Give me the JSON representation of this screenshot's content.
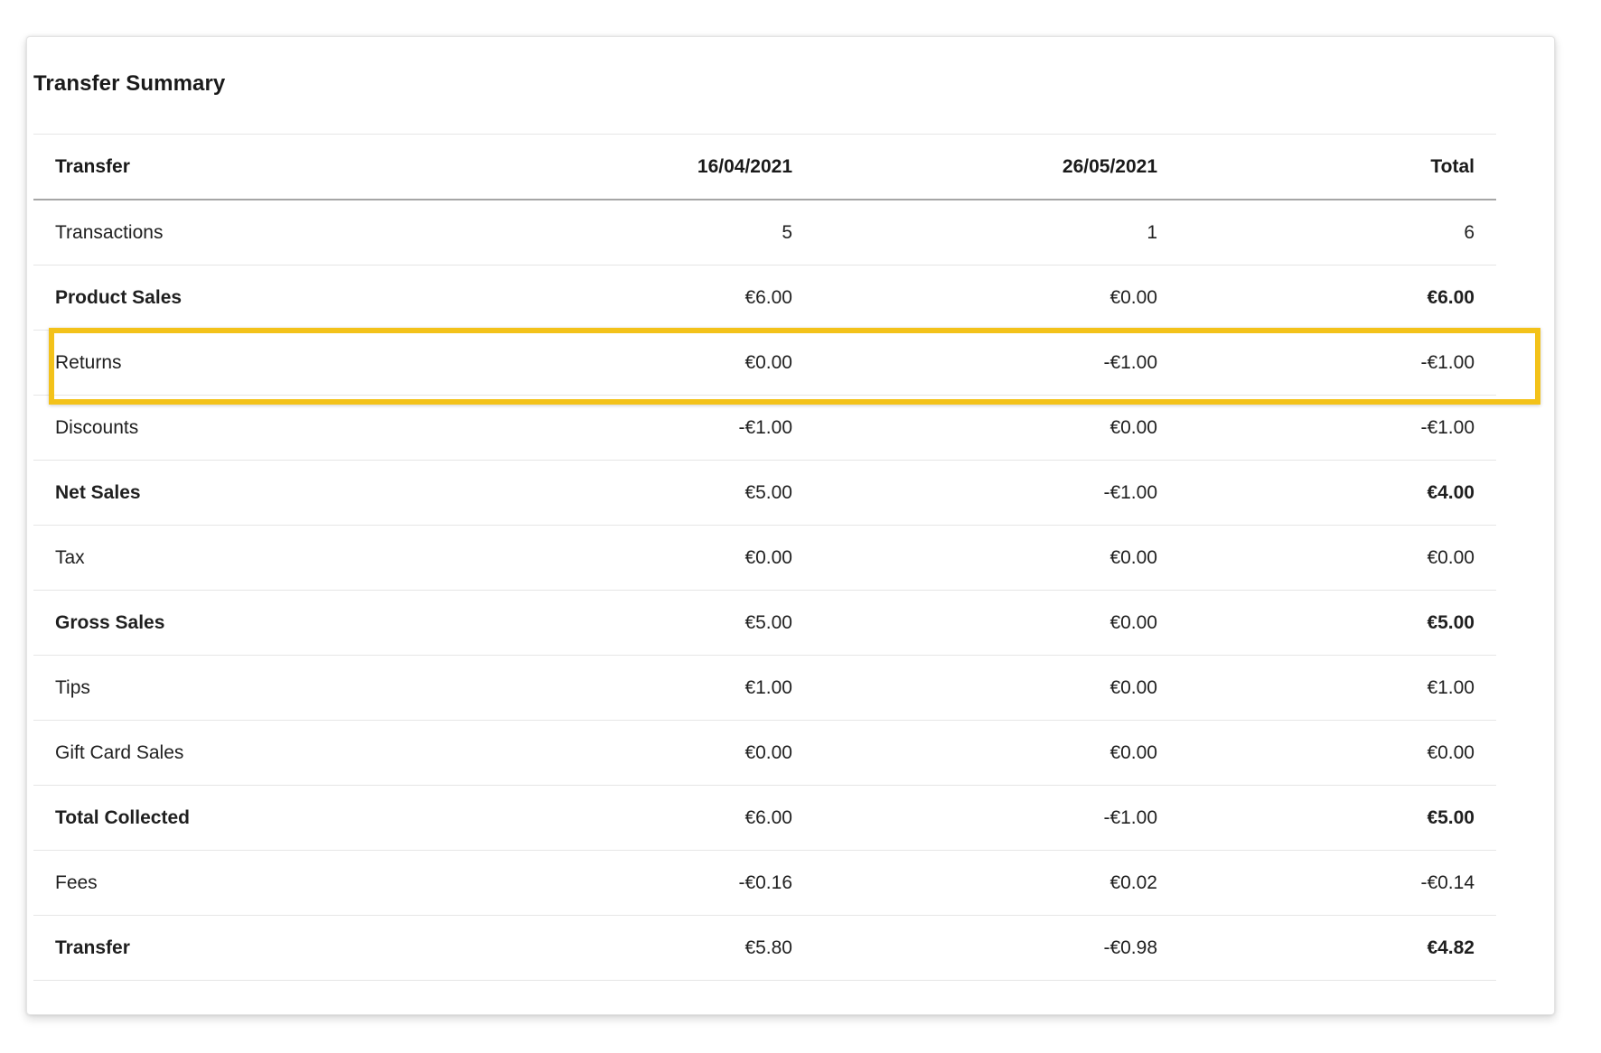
{
  "title": "Transfer Summary",
  "columns": [
    "Transfer",
    "16/04/2021",
    "26/05/2021",
    "Total"
  ],
  "rows": [
    {
      "label": "Transactions",
      "values": [
        "5",
        "1",
        "6"
      ],
      "bold": false
    },
    {
      "label": "Product Sales",
      "values": [
        "€6.00",
        "€0.00",
        "€6.00"
      ],
      "bold": true
    },
    {
      "label": "Returns",
      "values": [
        "€0.00",
        "-€1.00",
        "-€1.00"
      ],
      "bold": false
    },
    {
      "label": "Discounts",
      "values": [
        "-€1.00",
        "€0.00",
        "-€1.00"
      ],
      "bold": false
    },
    {
      "label": "Net Sales",
      "values": [
        "€5.00",
        "-€1.00",
        "€4.00"
      ],
      "bold": true
    },
    {
      "label": "Tax",
      "values": [
        "€0.00",
        "€0.00",
        "€0.00"
      ],
      "bold": false
    },
    {
      "label": "Gross Sales",
      "values": [
        "€5.00",
        "€0.00",
        "€5.00"
      ],
      "bold": true
    },
    {
      "label": "Tips",
      "values": [
        "€1.00",
        "€0.00",
        "€1.00"
      ],
      "bold": false
    },
    {
      "label": "Gift Card Sales",
      "values": [
        "€0.00",
        "€0.00",
        "€0.00"
      ],
      "bold": false
    },
    {
      "label": "Total Collected",
      "values": [
        "€6.00",
        "-€1.00",
        "€5.00"
      ],
      "bold": true
    },
    {
      "label": "Fees",
      "values": [
        "-€0.16",
        "€0.02",
        "-€0.14"
      ],
      "bold": false
    },
    {
      "label": "Transfer",
      "values": [
        "€5.80",
        "-€0.98",
        "€4.82"
      ],
      "bold": true
    }
  ],
  "highlighted_row": "Returns",
  "colors": {
    "highlight": "#f3c21a",
    "text": "#1f1f1f",
    "header_rule": "#a6a6a6",
    "row_rule": "#e6e6e6"
  }
}
